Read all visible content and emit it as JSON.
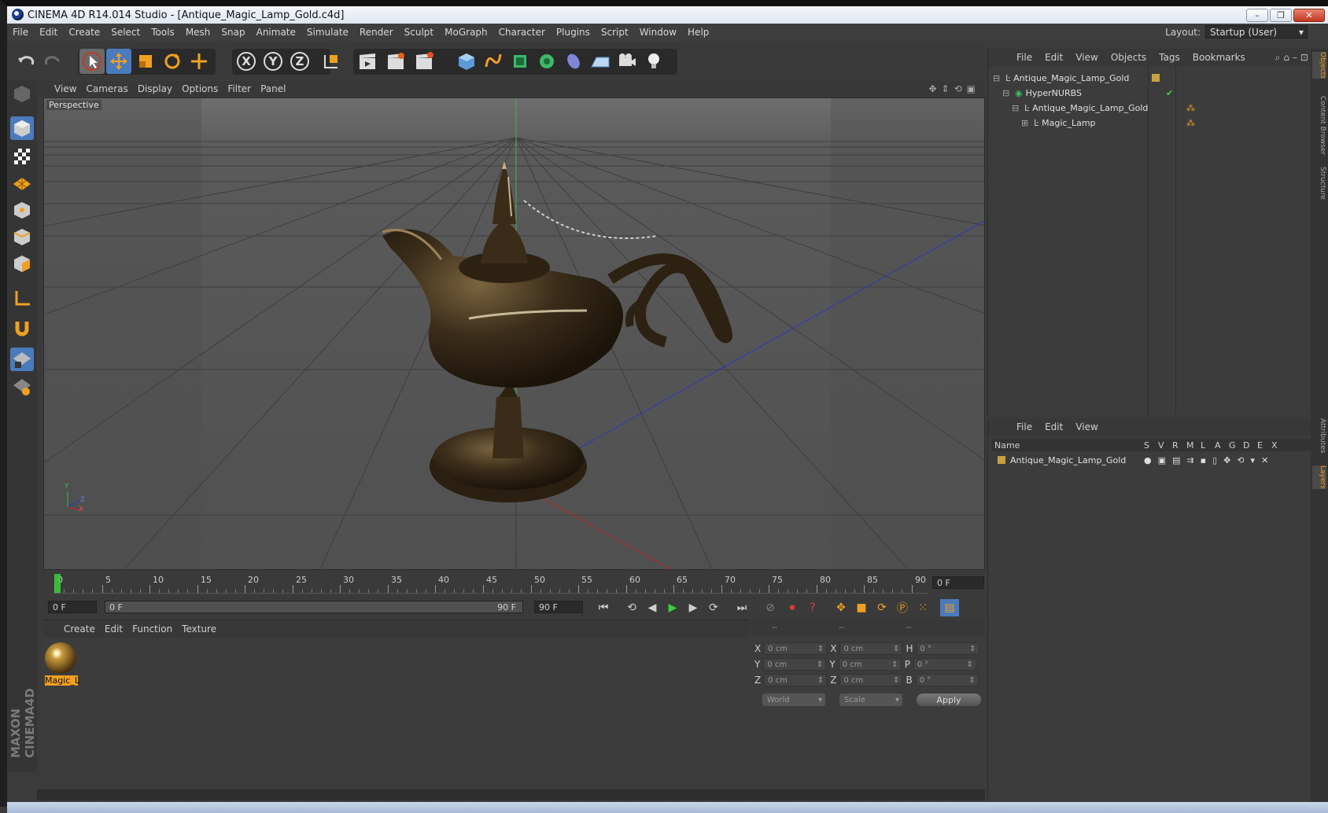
{
  "window": {
    "title": "CINEMA 4D R14.014 Studio - [Antique_Magic_Lamp_Gold.c4d]",
    "minimize": "–",
    "maximize": "❐",
    "close": "✕"
  },
  "menu": [
    "File",
    "Edit",
    "Create",
    "Select",
    "Tools",
    "Mesh",
    "Snap",
    "Animate",
    "Simulate",
    "Render",
    "Sculpt",
    "MoGraph",
    "Character",
    "Plugins",
    "Script",
    "Window",
    "Help"
  ],
  "layout": {
    "label": "Layout:",
    "value": "Startup (User)"
  },
  "toolbar": {
    "axis_x": "X",
    "axis_y": "Y",
    "axis_z": "Z"
  },
  "viewport": {
    "menu": [
      "View",
      "Cameras",
      "Display",
      "Options",
      "Filter",
      "Panel"
    ],
    "label": "Perspective",
    "axis_y": "Y",
    "axis_z": "Z",
    "axis_x": "X"
  },
  "timeline": {
    "ticks": [
      "0",
      "5",
      "10",
      "15",
      "20",
      "25",
      "30",
      "35",
      "40",
      "45",
      "50",
      "55",
      "60",
      "65",
      "70",
      "75",
      "80",
      "85",
      "90"
    ],
    "current_frame": "0 F",
    "start_frame": "0 F",
    "range_start": "0 F",
    "range_end": "90 F",
    "end_frame": "90 F"
  },
  "material_panel": {
    "menu": [
      "Create",
      "Edit",
      "Function",
      "Texture"
    ],
    "materials": [
      {
        "name": "Magic_L"
      }
    ]
  },
  "coords": {
    "headers": [
      "--",
      "--",
      "--"
    ],
    "rows": [
      {
        "a": "X",
        "av": "0 cm",
        "b": "X",
        "bv": "0 cm",
        "c": "H",
        "cv": "0 °"
      },
      {
        "a": "Y",
        "av": "0 cm",
        "b": "Y",
        "bv": "0 cm",
        "c": "P",
        "cv": "0 °"
      },
      {
        "a": "Z",
        "av": "0 cm",
        "b": "Z",
        "bv": "0 cm",
        "c": "B",
        "cv": "0 °"
      }
    ],
    "mode1": "World",
    "mode2": "Scale",
    "apply": "Apply"
  },
  "objects_panel": {
    "menu": [
      "File",
      "Edit",
      "View",
      "Objects",
      "Tags",
      "Bookmarks"
    ],
    "tree": [
      {
        "name": "Antique_Magic_Lamp_Gold",
        "indent": 0
      },
      {
        "name": "HyperNURBS",
        "indent": 1
      },
      {
        "name": "Antique_Magic_Lamp_Gold",
        "indent": 2
      },
      {
        "name": "Magic_Lamp",
        "indent": 3
      }
    ]
  },
  "layers_panel": {
    "menu": [
      "File",
      "Edit",
      "View"
    ],
    "columns": [
      "Name",
      "S",
      "V",
      "R",
      "M",
      "L",
      "A",
      "G",
      "D",
      "E",
      "X"
    ],
    "rows": [
      {
        "name": "Antique_Magic_Lamp_Gold"
      }
    ]
  },
  "side_tabs": [
    "Objects",
    "Content Browser",
    "Structure",
    "Attributes",
    "Layers"
  ],
  "branding": "MAXON CINEMA4D",
  "colors": {
    "accent": "#f0a020",
    "layer": "#c8a040",
    "play": "#3ad13a",
    "grid": "#6a6a6a"
  }
}
